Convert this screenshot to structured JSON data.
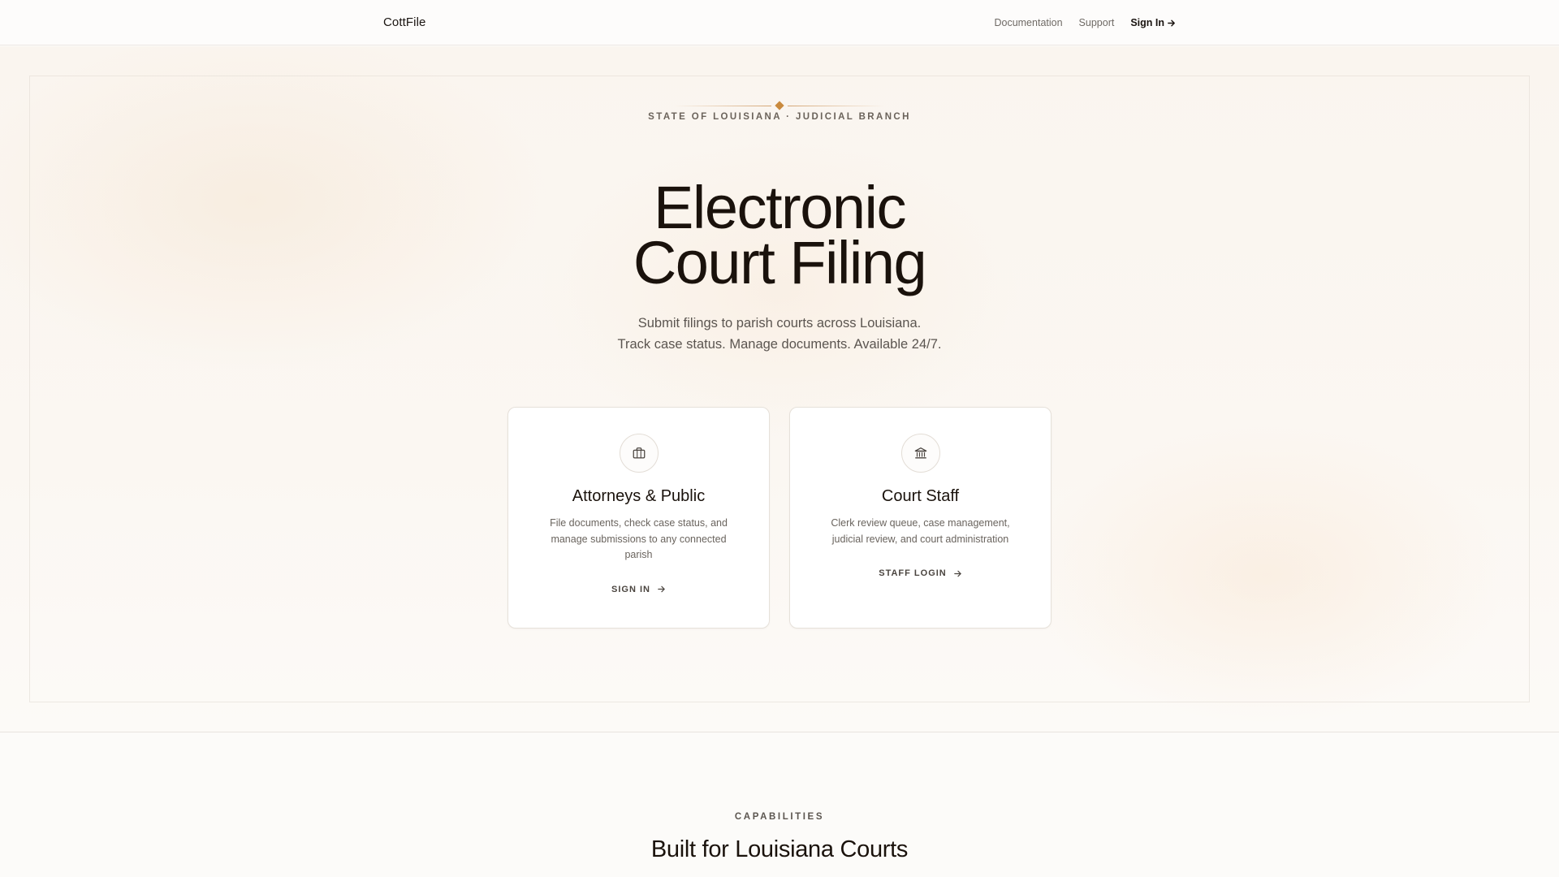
{
  "header": {
    "brand": "CottFile",
    "nav": {
      "documentation": "Documentation",
      "support": "Support",
      "sign_in": "Sign In"
    }
  },
  "hero": {
    "eyebrow": "STATE OF LOUISIANA · JUDICIAL BRANCH",
    "headline_line1": "Electronic",
    "headline_line2": "Court Filing",
    "subtext_line1": "Submit filings to parish courts across Louisiana.",
    "subtext_line2": "Track case status. Manage documents. Available 24/7.",
    "accent_color": "#c98a3e"
  },
  "cards": [
    {
      "icon": "briefcase-icon",
      "title": "Attorneys & Public",
      "description": "File documents, check case status, and manage submissions to any connected parish",
      "cta": "SIGN IN"
    },
    {
      "icon": "courthouse-icon",
      "title": "Court Staff",
      "description": "Clerk review queue, case management, judicial review, and court administration",
      "cta": "STAFF LOGIN"
    }
  ],
  "capabilities": {
    "label": "CAPABILITIES",
    "title": "Built for Louisiana Courts"
  }
}
